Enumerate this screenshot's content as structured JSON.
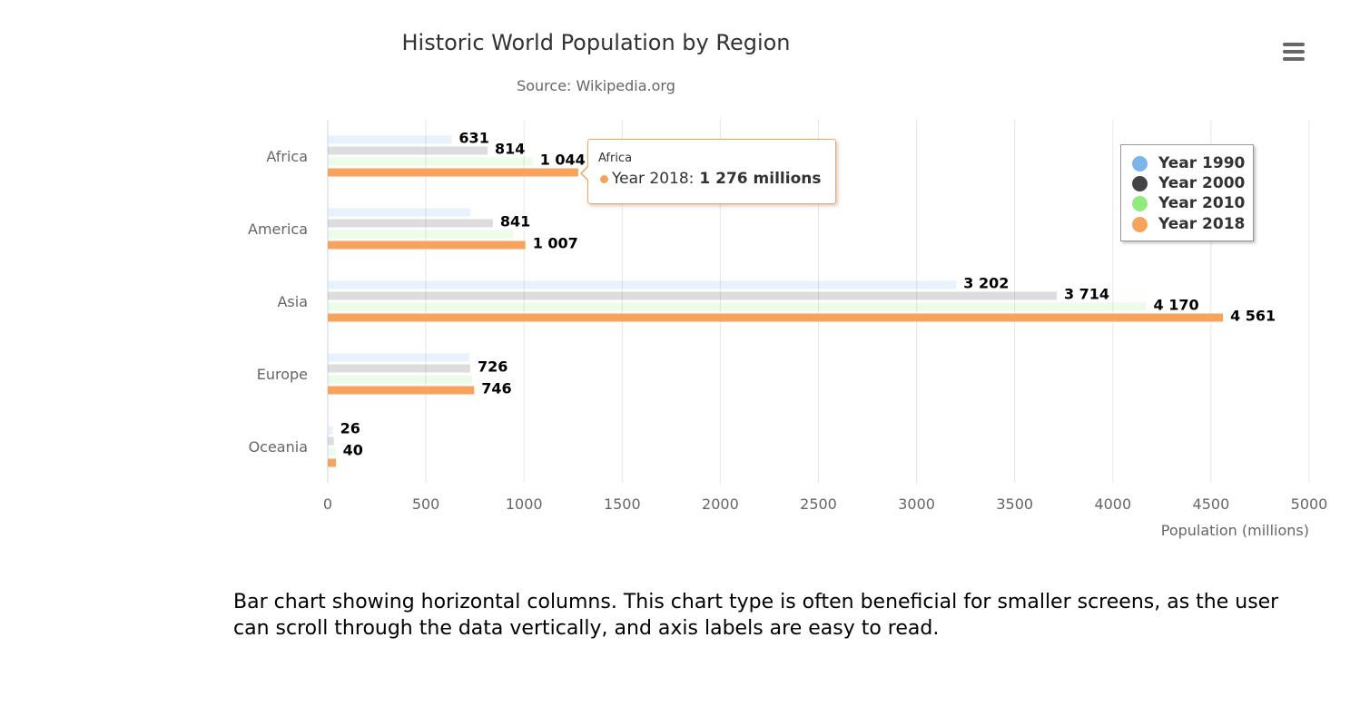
{
  "chart_data": {
    "type": "bar",
    "orientation": "horizontal",
    "title": "Historic World Population by Region",
    "subtitle": "Source: Wikipedia.org",
    "categories": [
      "Africa",
      "America",
      "Asia",
      "Europe",
      "Oceania"
    ],
    "series": [
      {
        "name": "Year 1990",
        "color": "#7cb5ec",
        "values": [
          631,
          727,
          3202,
          721,
          26
        ],
        "labels": [
          "631",
          "",
          "3 202",
          "",
          "26"
        ]
      },
      {
        "name": "Year 2000",
        "color": "#434348",
        "values": [
          814,
          841,
          3714,
          726,
          31
        ],
        "labels": [
          "814",
          "841",
          "3 714",
          "726",
          ""
        ]
      },
      {
        "name": "Year 2010",
        "color": "#90ed7d",
        "values": [
          1044,
          944,
          4170,
          735,
          40
        ],
        "labels": [
          "1 044",
          "",
          "4 170",
          "",
          "40"
        ]
      },
      {
        "name": "Year 2018",
        "color": "#f7a35c",
        "values": [
          1276,
          1007,
          4561,
          746,
          42
        ],
        "labels": [
          "",
          "1 007",
          "4 561",
          "746",
          ""
        ]
      }
    ],
    "highlighted_series": "Year 2018",
    "xlabel": "Population (millions)",
    "xlim": [
      0,
      5000
    ],
    "ticks": [
      "0",
      "500",
      "1000",
      "1500",
      "2000",
      "2500",
      "3000",
      "3500",
      "4000",
      "4500",
      "5000"
    ],
    "grid": true,
    "legend_position": "top-right"
  },
  "tooltip": {
    "category": "Africa",
    "series_label": "Year 2018:",
    "value_text": "1 276 millions",
    "color": "#f7a35c"
  },
  "caption": "Bar chart showing horizontal columns. This chart type is often beneficial for smaller screens, as the user can scroll through the data vertically, and axis labels are easy to read.",
  "menu_icon": "hamburger-menu-icon"
}
